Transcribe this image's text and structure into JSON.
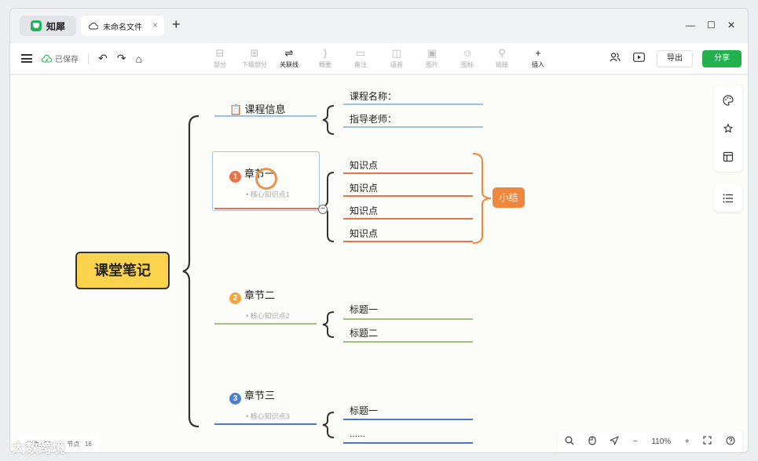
{
  "app": {
    "name": "知犀",
    "doc_tab": "未命名文件",
    "new_tab": "+",
    "tab_close": "×",
    "window_controls": {
      "minimize": "—",
      "maximize": "☐",
      "close": "✕"
    }
  },
  "toolbar": {
    "saved": "已保存",
    "tools": [
      {
        "label": "部分",
        "icon": "part-icon",
        "active": false
      },
      {
        "label": "下级部分",
        "icon": "subpart-icon",
        "active": false
      },
      {
        "label": "关联线",
        "icon": "relation-line-icon",
        "active": true
      },
      {
        "label": "概要",
        "icon": "summary-icon",
        "active": false
      },
      {
        "label": "备注",
        "icon": "note-icon",
        "active": false
      },
      {
        "label": "语音",
        "icon": "voice-icon",
        "active": false
      },
      {
        "label": "图片",
        "icon": "image-icon",
        "active": false
      },
      {
        "label": "图标",
        "icon": "emoji-icon",
        "active": false
      },
      {
        "label": "链接",
        "icon": "link-icon",
        "active": false
      },
      {
        "label": "插入",
        "icon": "insert-icon",
        "active": true
      }
    ],
    "export": "导出",
    "share": "分享"
  },
  "mindmap": {
    "root": "课堂笔记",
    "course_info": {
      "title": "课程信息",
      "children": [
        "课程名称：",
        "指导老师："
      ]
    },
    "chapters": [
      {
        "number": "1",
        "title": "章节一",
        "sub": "核心知识点1",
        "children": [
          "知识点",
          "知识点",
          "知识点",
          "知识点"
        ],
        "summary": "小结"
      },
      {
        "number": "2",
        "title": "章节二",
        "sub": "核心知识点2",
        "children": [
          "标题一",
          "标题二"
        ]
      },
      {
        "number": "3",
        "title": "章节三",
        "sub": "核心知识点3",
        "children": [
          "标题一",
          "......"
        ]
      }
    ]
  },
  "colors": {
    "blue_line": "#9cc3de",
    "orange": "#f0873f",
    "chapter1": "#e5744d",
    "chapter2": "#f2a63a",
    "chapter3": "#4a7fd0",
    "green_line": "#a4be7c",
    "dark_blue_line": "#4a78c4",
    "root_fill": "#fcd34d",
    "share_btn": "#23b14d"
  },
  "status": {
    "words_label": "字数",
    "words": "53",
    "nodes_label": "节点",
    "nodes": "16"
  },
  "zoom": {
    "level": "110%",
    "minus": "−",
    "plus": "+"
  },
  "watermark": "大数跨境"
}
